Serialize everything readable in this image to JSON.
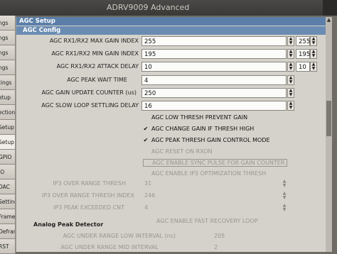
{
  "window": {
    "title": "ADRV9009 Advanced"
  },
  "side_tabs": [
    "ngs",
    "ngs",
    "ngs",
    "ngs",
    "tings",
    "etup",
    "ection",
    "Setup",
    "Setup",
    "GPIO",
    "IO",
    "DAC",
    "Settings",
    "Framer",
    "Deframer",
    "RST"
  ],
  "panel": {
    "header": "AGC Setup",
    "subheader": "AGC Config",
    "rows": [
      {
        "label": "AGC RX1/RX2 MAX GAIN INDEX",
        "value": "255",
        "value2": "255"
      },
      {
        "label": "AGC RX1/RX2 MIN GAIN INDEX",
        "value": "195",
        "value2": "195"
      },
      {
        "label": "AGC RX1/RX2 ATTACK DELAY",
        "value": "10",
        "value2": "10"
      },
      {
        "label": "AGC PEAK WAIT TIME",
        "value": "4"
      },
      {
        "label": "AGC GAIN UPDATE COUNTER (us)",
        "value": "250"
      },
      {
        "label": "AGC SLOW LOOP SETTLING DELAY",
        "value": "16"
      }
    ],
    "checks": [
      {
        "label": "AGC LOW THRESH PREVENT GAIN",
        "checked": false,
        "enabled": true
      },
      {
        "label": "AGC CHANGE GAIN IF THRESH HIGH",
        "checked": true,
        "enabled": true
      },
      {
        "label": "AGC PEAK THRESH GAIN CONTROL MODE",
        "checked": true,
        "enabled": true
      },
      {
        "label": "AGC RESET ON RXON",
        "checked": false,
        "enabled": false
      },
      {
        "label": "AGC ENABLE SYNC PULSE FOR GAIN COUNTER",
        "checked": false,
        "enabled": false
      },
      {
        "label": "AGC ENABLE IP3 OPTIMIZATION THRESH",
        "checked": false,
        "enabled": false
      }
    ],
    "ip3_rows": [
      {
        "label": "IP3 OVER RANGE THRESH",
        "value": "31"
      },
      {
        "label": "IP3 OVER RANGE THRESH INDEX",
        "value": "246"
      },
      {
        "label": "IP3 PEAK EXCEEDED CNT",
        "value": "4"
      }
    ],
    "fast_recovery": "AGC ENABLE FAST RECOVERY LOOP",
    "analog_title": "Analog Peak Detector",
    "analog_rows": [
      {
        "label": "AGC UNDER RANGE LOW INTERVAL (ns)",
        "value": "205"
      },
      {
        "label": "AGC UNDER RANGE MID INTERVAL",
        "value": "2"
      }
    ]
  },
  "colors": {
    "header": "#5b7fa8",
    "background": "#d5d2cb"
  }
}
